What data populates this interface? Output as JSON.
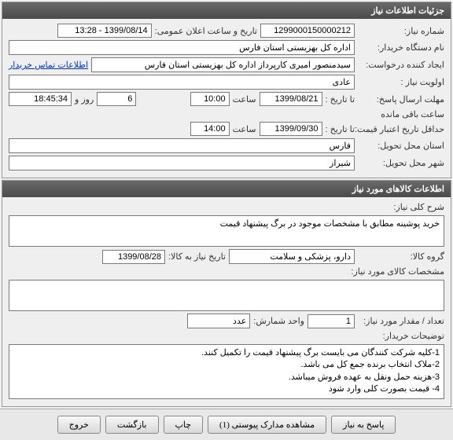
{
  "panel1": {
    "title": "جزئیات اطلاعات نیاز",
    "need_no_label": "شماره نیاز:",
    "need_no": "1299000150000212",
    "announce_label": "تاریخ و ساعت اعلان عمومی:",
    "announce_value": "1399/08/14 - 13:28",
    "buyer_org_label": "نام دستگاه خریدار:",
    "buyer_org": "اداره کل بهزیستی استان فارس",
    "requester_label": "ایجاد کننده درخواست:",
    "requester": "سیدمنصور امیری کارپرداز اداره کل بهزیستی استان فارس",
    "contact_link": "اطلاعات تماس خریدار",
    "priority_label": "اولویت نیاز :",
    "priority": "عادی",
    "deadline_label": "مهلت ارسال پاسخ:",
    "until_label": "تا تاریخ :",
    "deadline_date": "1399/08/21",
    "time_label": "ساعت",
    "deadline_time": "10:00",
    "days": "6",
    "days_label": "روز و",
    "remain_time": "18:45:34",
    "remain_label": "ساعت باقی مانده",
    "min_validity_label": "حداقل تاریخ اعتبار قیمت:",
    "min_validity_until": "تا تاریخ :",
    "min_validity_date": "1399/09/30",
    "min_validity_time": "14:00",
    "province_label": "استان محل تحویل:",
    "province": "فارس",
    "city_label": "شهر محل تحویل:",
    "city": "شیراز"
  },
  "panel2": {
    "title": "اطلاعات کالاهای مورد نیاز",
    "desc_label": "شرح کلی نیاز:",
    "desc": "خرید پوشینه مطابق با مشخصات موجود در برگ پیشنهاد قیمت",
    "group_label": "گروه کالا:",
    "group": "دارو، پزشکی و سلامت",
    "need_by_label": "تاریخ نیاز به کالا:",
    "need_by": "1399/08/28",
    "spec_label": "مشخصات کالای مورد نیاز:",
    "spec": "",
    "qty_label": "تعداد / مقدار مورد نیاز:",
    "qty": "1",
    "unit_label": "واحد شمارش:",
    "unit": "عدد",
    "notes_label": "توضیحات خریدار:",
    "notes": "1-کلیه شرکت کنندگان می بایست برگ پیشنهاد قیمت را تکمیل کنند.\n2-ملاک انتخاب برنده جمع کل می باشد.\n3-هزینه حمل ونقل به عهده فروش میباشد.\n4- قیمت بصورت کلی وارد شود"
  },
  "buttons": {
    "reply": "پاسخ به نیاز",
    "attachments": "مشاهده مدارک پیوستی (1)",
    "print": "چاپ",
    "back": "بازگشت",
    "exit": "خروج"
  }
}
